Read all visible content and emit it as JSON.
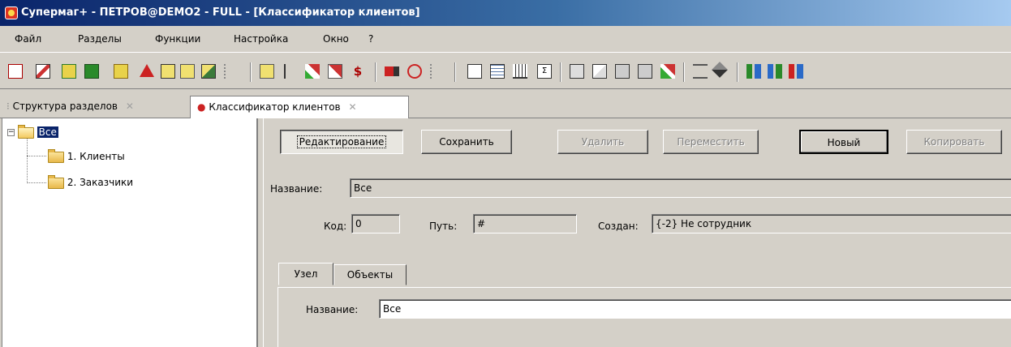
{
  "window": {
    "title": "Супермаг+ - ПЕТРОВ@DEMO2 - FULL - [Классификатор клиентов]"
  },
  "menu": [
    {
      "label": "Файл"
    },
    {
      "label": "Разделы"
    },
    {
      "label": "Функции"
    },
    {
      "label": "Настройка"
    },
    {
      "label": "Окно"
    },
    {
      "label": "?"
    }
  ],
  "toolbar": {
    "icons": [
      "report-icon",
      "chart-icon",
      "sheet-icon",
      "table-icon",
      "ledger-icon",
      "triangle-icon",
      "letter-a-icon",
      "percent-icon",
      "edit-icon",
      "tree-icon",
      "book-icon",
      "arrow-icon",
      "pen-icon",
      "check-icon",
      "dollar-icon",
      "truck-icon",
      "people-icon",
      "tree2-icon",
      "copy-icon",
      "grid-icon",
      "columns-icon",
      "sigma-icon",
      "gift-icon",
      "exchange-icon",
      "box-icon",
      "package-icon",
      "edit2-icon",
      "scales-icon",
      "tag-icon",
      "hierarchy-icon",
      "hierarchy2-icon",
      "hierarchy3-icon"
    ]
  },
  "doc_tabs": [
    {
      "label": "Структура разделов",
      "close": "✕"
    },
    {
      "label": "Классификатор клиентов",
      "close": "✕"
    }
  ],
  "tree": {
    "root": "Все",
    "expander": "−",
    "children": [
      "1. Клиенты",
      "2. Заказчики"
    ]
  },
  "actions": {
    "edit": "Редактирование",
    "save": "Сохранить",
    "delete": "Удалить",
    "move": "Переместить",
    "new": "Новый",
    "copy": "Копировать"
  },
  "form": {
    "name_label": "Название:",
    "name_value": "Все",
    "code_label": "Код:",
    "code_value": "0",
    "path_label": "Путь:",
    "path_value": "#",
    "created_label": "Создан:",
    "created_value": "{-2} Не сотрудник"
  },
  "inner_tabs": [
    {
      "label": "Узел"
    },
    {
      "label": "Объекты"
    }
  ],
  "node": {
    "name_label": "Название:",
    "name_value": "Все"
  }
}
